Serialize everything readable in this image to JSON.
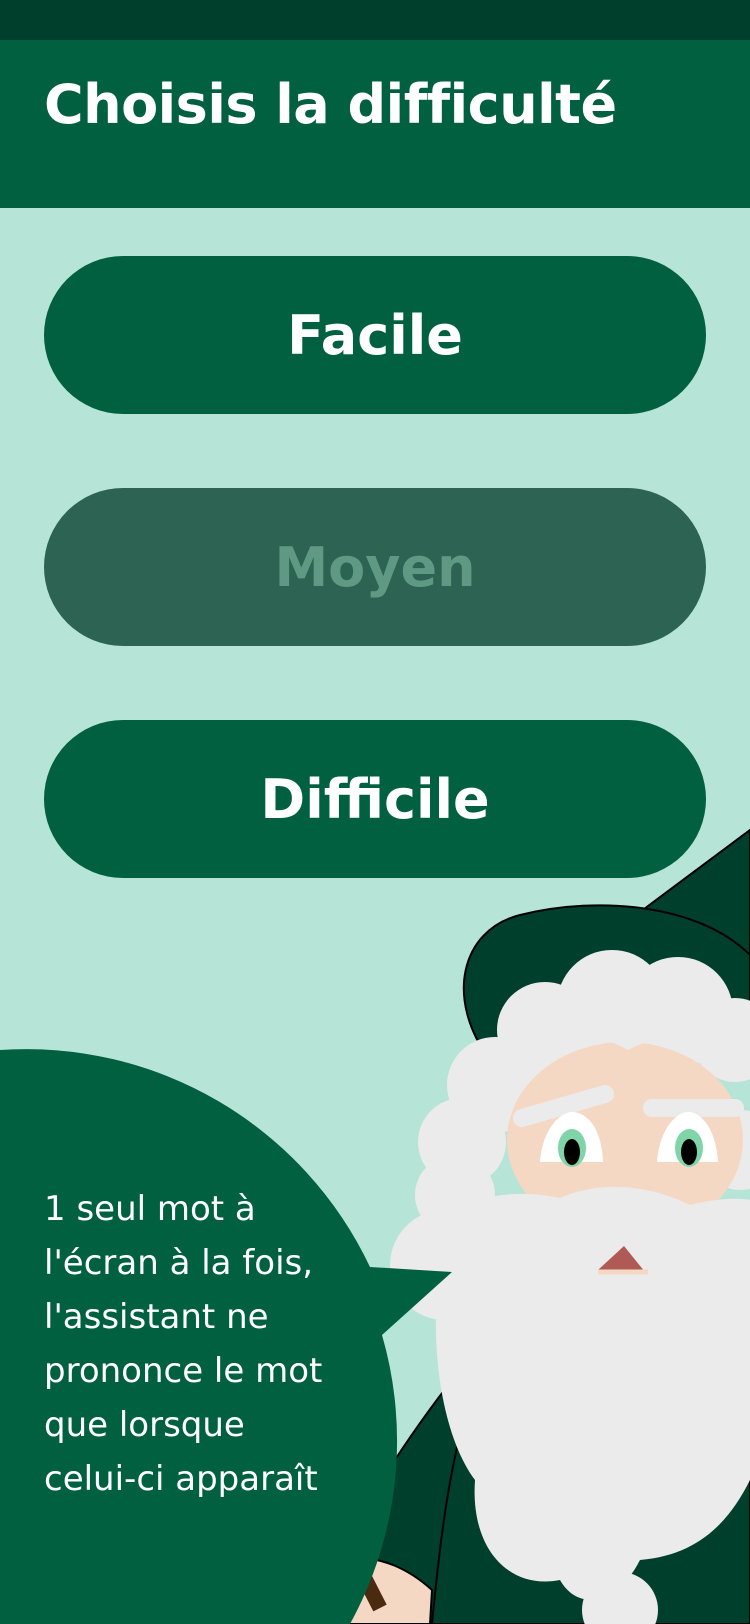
{
  "header": {
    "title": "Choisis la difficulté"
  },
  "difficulty_buttons": [
    {
      "label": "Facile",
      "enabled": true
    },
    {
      "label": "Moyen",
      "enabled": false
    },
    {
      "label": "Difficile",
      "enabled": true
    }
  ],
  "assistant": {
    "speech_lines": [
      "1 seul mot à",
      "l'écran à la fois,",
      "l'assistant ne",
      "prononce le mot",
      "que lorsque",
      "celui-ci apparaît"
    ]
  },
  "colors": {
    "background": "#b6e5d7",
    "primary": "#01603f",
    "primary_dark": "#003f2b",
    "disabled_button": "#2d6352",
    "disabled_text": "#5f9984",
    "beard": "#ebebeb"
  }
}
